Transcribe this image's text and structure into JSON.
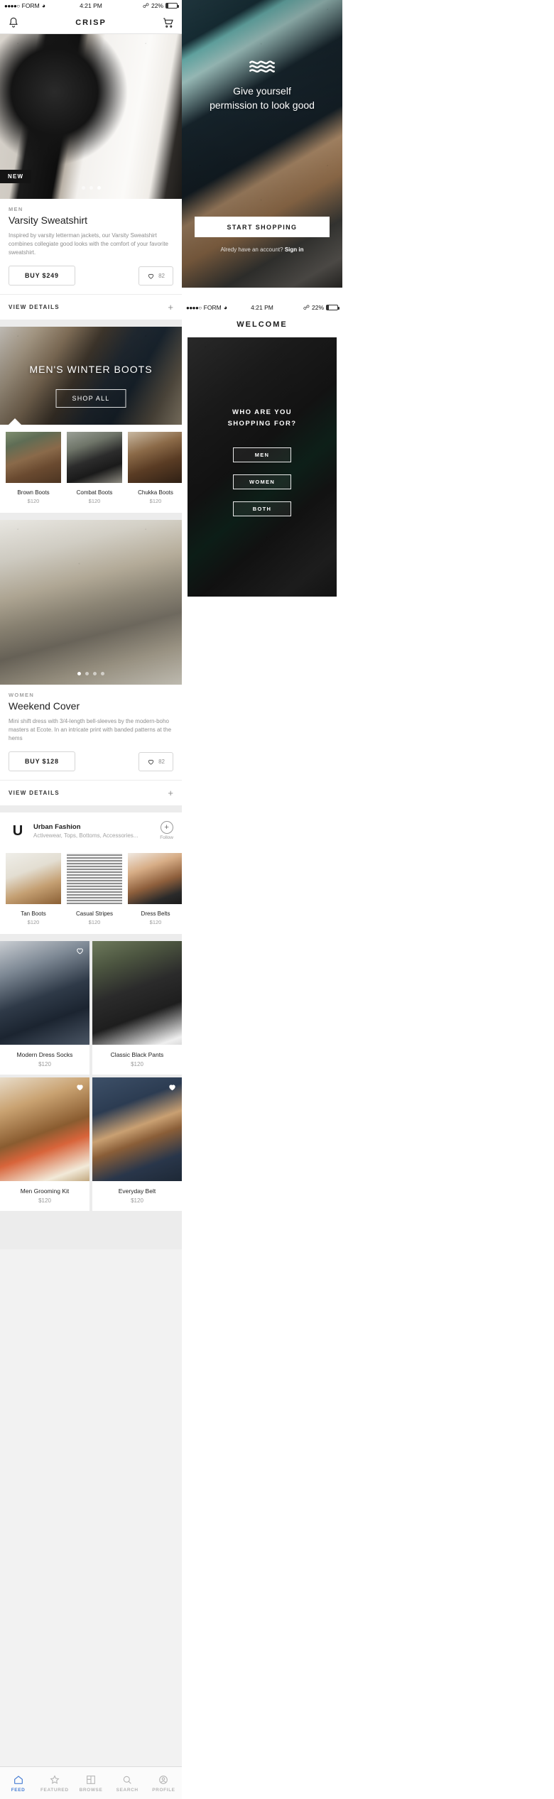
{
  "status_bar": {
    "signal_dots": "●●●●○",
    "carrier": "FORM",
    "wifi_icon": "wifi-icon",
    "time": "4:21 PM",
    "bluetooth_icon": "bluetooth-icon",
    "battery_percent": "22%",
    "battery_level": 22
  },
  "left_panel": {
    "navbar": {
      "bell_icon": "bell-icon",
      "title": "CRISP",
      "cart_icon": "cart-icon"
    },
    "cards": [
      {
        "badge": "NEW",
        "eyebrow": "MEN",
        "title": "Varsity Sweatshirt",
        "description": "Inspired by varsity letterman jackets, our Varsity Sweatshirt combines collegiate good looks with the comfort of your favorite sweatshirt.",
        "buy_label": "BUY $249",
        "like_count": "82",
        "view_details_label": "VIEW DETAILS",
        "view_details_plus": "+",
        "dots_total": 3,
        "dots_active": 2
      },
      {
        "eyebrow": "WOMEN",
        "title": "Weekend Cover",
        "description": "Mini shift dress with 3/4-length bell-sleeves by the modern-boho masters at Ecote. In an intricate print with banded patterns at the hems",
        "buy_label": "BUY $128",
        "like_count": "82",
        "view_details_label": "VIEW DETAILS",
        "view_details_plus": "+",
        "dots_total": 4,
        "dots_active": 0
      }
    ],
    "banner": {
      "title": "MEN'S WINTER BOOTS",
      "button_label": "SHOP ALL"
    },
    "boot_tiles": [
      {
        "name": "Brown Boots",
        "price": "$120"
      },
      {
        "name": "Combat Boots",
        "price": "$120"
      },
      {
        "name": "Chukka Boots",
        "price": "$120"
      }
    ],
    "brand": {
      "logo_letter": "U",
      "name": "Urban Fashion",
      "categories": "Activewear, Tops, Bottoms, Accessories...",
      "follow_icon": "plus-circle-icon",
      "follow_label": "Follow"
    },
    "brand_tiles": [
      {
        "name": "Tan Boots",
        "price": "$120"
      },
      {
        "name": "Casual Stripes",
        "price": "$120"
      },
      {
        "name": "Dress Belts",
        "price": "$120"
      }
    ],
    "grid_items": [
      {
        "name": "Modern Dress Socks",
        "price": "$120",
        "liked": false
      },
      {
        "name": "Classic Black Pants",
        "price": "$120",
        "liked": false
      },
      {
        "name": "Men Grooming Kit",
        "price": "$120",
        "liked": true
      },
      {
        "name": "Everyday Belt",
        "price": "$120",
        "liked": true
      }
    ],
    "tabbar": [
      {
        "label": "FEED",
        "icon": "home-icon",
        "active": true
      },
      {
        "label": "FEATURED",
        "icon": "star-icon",
        "active": false
      },
      {
        "label": "BROWSE",
        "icon": "grid-icon",
        "active": false
      },
      {
        "label": "SEARCH",
        "icon": "search-icon",
        "active": false
      },
      {
        "label": "PROFILE",
        "icon": "person-icon",
        "active": false
      }
    ]
  },
  "right_top_panel": {
    "logo_icon": "waves-icon",
    "headline_line1": "Give yourself",
    "headline_line2": "permission to look good",
    "cta_label": "START SHOPPING",
    "signin_prefix": "Alredy have an account?",
    "signin_link": "Sign in"
  },
  "right_bottom_panel": {
    "navbar_title": "WELCOME",
    "question_line1": "WHO ARE YOU",
    "question_line2": "SHOPPING FOR?",
    "options": [
      {
        "label": "MEN"
      },
      {
        "label": "WOMEN"
      },
      {
        "label": "BOTH"
      }
    ]
  }
}
